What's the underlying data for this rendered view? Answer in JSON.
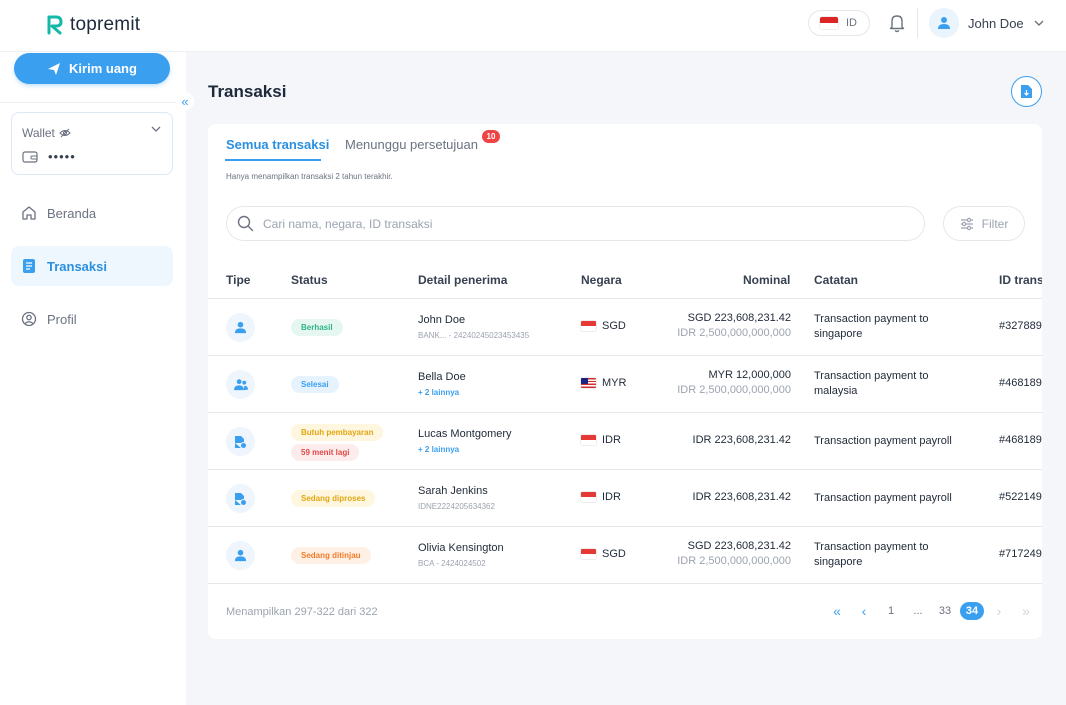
{
  "app": {
    "logo_text": "topremit",
    "language": "ID",
    "user_name": "John Doe"
  },
  "sidebar": {
    "send_button": "Kirim uang",
    "wallet": {
      "title": "Wallet",
      "balance_hidden": "•••••"
    },
    "items": [
      {
        "label": "Beranda",
        "icon": "home-icon"
      },
      {
        "label": "Transaksi",
        "icon": "document-icon",
        "active": true
      },
      {
        "label": "Profil",
        "icon": "user-circle-icon"
      }
    ]
  },
  "main": {
    "title": "Transaksi",
    "tabs": [
      {
        "label": "Semua transaksi"
      },
      {
        "label": "Menunggu persetujuan",
        "badge": "10"
      }
    ],
    "note": "Hanya menampilkan transaksi 2 tahun terakhir.",
    "search": {
      "placeholder": "Cari nama, negara, ID transaksi"
    },
    "filter_label": "Filter"
  },
  "table": {
    "columns": [
      "Tipe",
      "Status",
      "Detail penerima",
      "Negara",
      "Nominal",
      "Catatan",
      "ID trans"
    ],
    "rows": [
      {
        "type_icon": "user-icon",
        "status": [
          "Berhasil"
        ],
        "name": "John Doe",
        "detail": "BANK... - 24240245023453435",
        "country": "SGD",
        "nominal": "SGD 223,608,231.42",
        "nominal_sub": "IDR 2,500,000,000,000",
        "note": "Transaction payment to singapore",
        "id": "#327889"
      },
      {
        "type_icon": "users-icon",
        "status": [
          "Selesai"
        ],
        "name": "Bella Doe",
        "detail": "+ 2 lainnya",
        "country": "MYR",
        "nominal": "MYR 12,000,000",
        "nominal_sub": "IDR 2,500,000,000,000",
        "note": "Transaction payment to malaysia",
        "id": "#468189"
      },
      {
        "type_icon": "payroll-document-icon",
        "status": [
          "Butuh pembayaran",
          "59 menit lagi"
        ],
        "name": "Lucas Montgomery",
        "detail": "+ 2 lainnya",
        "country": "IDR",
        "nominal": "IDR 223,608,231.42",
        "nominal_sub": "",
        "note": "Transaction payment payroll",
        "id": "#468189"
      },
      {
        "type_icon": "payroll-document-icon",
        "status": [
          "Sedang diproses"
        ],
        "name": "Sarah Jenkins",
        "detail": "IDNE2224205634362",
        "country": "IDR",
        "nominal": "IDR 223,608,231.42",
        "nominal_sub": "",
        "note": "Transaction payment payroll",
        "id": "#522149"
      },
      {
        "type_icon": "user-icon",
        "status": [
          "Sedang ditinjau"
        ],
        "name": "Olivia Kensington",
        "detail": "BCA - 2424024502",
        "country": "SGD",
        "nominal": "SGD 223,608,231.42",
        "nominal_sub": "IDR 2,500,000,000,000",
        "note": "Transaction payment to singapore",
        "id": "#717249"
      }
    ]
  },
  "pagination": {
    "summary": "Menampilkan 297-322 dari 322",
    "pages": [
      "1",
      "...",
      "33",
      "34"
    ],
    "current": "34"
  },
  "colors": {
    "primary": "#3b9ff0",
    "brand_teal": "#14b8a6",
    "success": "#2fb487",
    "warning": "#e0a70f",
    "danger": "#e04848",
    "orange": "#f07b27"
  }
}
